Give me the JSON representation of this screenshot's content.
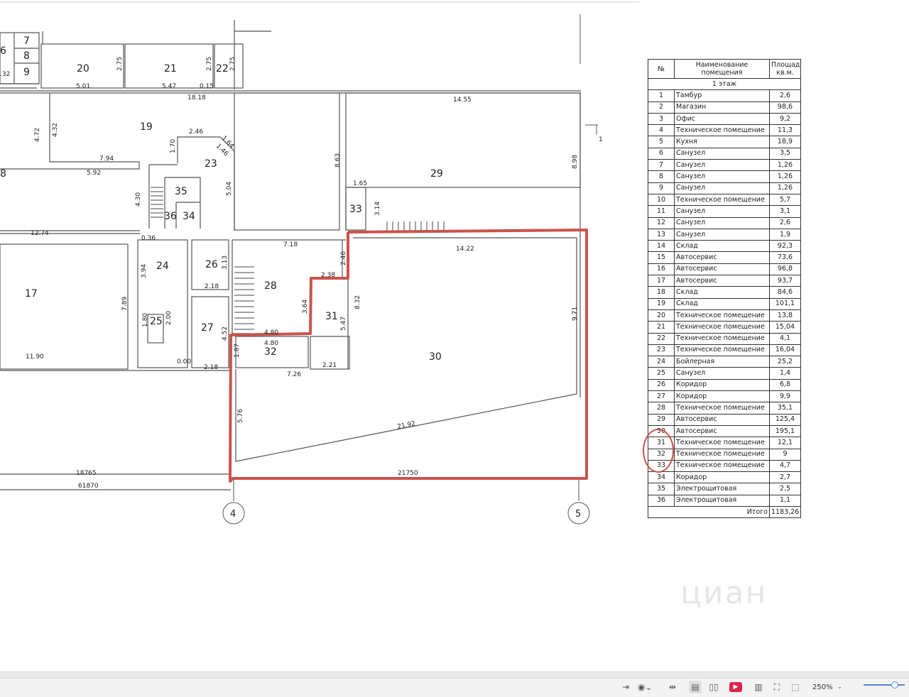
{
  "table": {
    "header_no": "№",
    "header_name": "Наименование помещения",
    "header_area": "Площадь, кв.м.",
    "floor_label": "1 этаж",
    "rooms": [
      {
        "no": "1",
        "name": "Тамбур",
        "area": "2,6"
      },
      {
        "no": "2",
        "name": "Магазин",
        "area": "98,6"
      },
      {
        "no": "3",
        "name": "Офис",
        "area": "9,2"
      },
      {
        "no": "4",
        "name": "Техническое помещение",
        "area": "11,3"
      },
      {
        "no": "5",
        "name": "Кухня",
        "area": "18,9"
      },
      {
        "no": "6",
        "name": "Санузел",
        "area": "3,5"
      },
      {
        "no": "7",
        "name": "Санузел",
        "area": "1,26"
      },
      {
        "no": "8",
        "name": "Санузел",
        "area": "1,26"
      },
      {
        "no": "9",
        "name": "Санузел",
        "area": "1,26"
      },
      {
        "no": "10",
        "name": "Техническое помещение",
        "area": "5,7"
      },
      {
        "no": "11",
        "name": "Санузел",
        "area": "3,1"
      },
      {
        "no": "12",
        "name": "Санузел",
        "area": "2,6"
      },
      {
        "no": "13",
        "name": "Санузел",
        "area": "1,9"
      },
      {
        "no": "14",
        "name": "Склад",
        "area": "92,3"
      },
      {
        "no": "15",
        "name": "Автосервис",
        "area": "73,6"
      },
      {
        "no": "16",
        "name": "Автосервис",
        "area": "96,8"
      },
      {
        "no": "17",
        "name": "Автосервис",
        "area": "93,7"
      },
      {
        "no": "18",
        "name": "Склад",
        "area": "84,6"
      },
      {
        "no": "19",
        "name": "Склад",
        "area": "101,1"
      },
      {
        "no": "20",
        "name": "Техническое помещение",
        "area": "13,8"
      },
      {
        "no": "21",
        "name": "Техническое помещение",
        "area": "15,04"
      },
      {
        "no": "22",
        "name": "Техническое помещение",
        "area": "4,1"
      },
      {
        "no": "23",
        "name": "Техническое помещение",
        "area": "16,04"
      },
      {
        "no": "24",
        "name": "Бойлерная",
        "area": "25,2"
      },
      {
        "no": "25",
        "name": "Санузел",
        "area": "1,4"
      },
      {
        "no": "26",
        "name": "Коридор",
        "area": "6,8"
      },
      {
        "no": "27",
        "name": "Коридор",
        "area": "9,9"
      },
      {
        "no": "28",
        "name": "Техническое помещение",
        "area": "35,1"
      },
      {
        "no": "29",
        "name": "Автосервис",
        "area": "125,4"
      },
      {
        "no": "30",
        "name": "Автосервис",
        "area": "195,1"
      },
      {
        "no": "31",
        "name": "Техническое помещение",
        "area": "12,1"
      },
      {
        "no": "32",
        "name": "Техническое помещение",
        "area": "9"
      },
      {
        "no": "33",
        "name": "Техническое помещение",
        "area": "4,7"
      },
      {
        "no": "34",
        "name": "Коридор",
        "area": "2,7"
      },
      {
        "no": "35",
        "name": "Электрощитовая",
        "area": "2,5"
      },
      {
        "no": "36",
        "name": "Электрощитовая",
        "area": "1,1"
      }
    ],
    "total_label": "Итого",
    "total_value": "1183,26"
  },
  "plan": {
    "rooms": {
      "r6": "6",
      "r7": "7",
      "r8": "8",
      "r9": "9",
      "r20": "20",
      "r21": "21",
      "r22": "22",
      "r19": "19",
      "r23": "23",
      "r29": "29",
      "r18": "8",
      "r35": "35",
      "r36": "36",
      "r34": "34",
      "r33": "33",
      "r17": "17",
      "r24": "24",
      "r26": "26",
      "r28": "28",
      "r31": "31",
      "r25": "25",
      "r27": "27",
      "r32": "32",
      "r30": "30"
    },
    "dims": {
      "d501": "5.01",
      "d547": "5.47",
      "d015": "0.15",
      "d275a": "2.75",
      "d275b": "2.75",
      "d275c": "2.75",
      "d32": ".32",
      "d1818": "18.18",
      "d1455": "14.55",
      "d472": "4.72",
      "d432": "4.32",
      "d246": "2.46",
      "d164": "1.64",
      "d146": "1.46",
      "d170": "1.70",
      "d794": "7.94",
      "d592": "5.92",
      "d863": "8.63",
      "d165": "1.65",
      "d314": "3.14",
      "d898": "8.98",
      "d504": "5.04",
      "d430": "4.30",
      "d1274": "12.74",
      "d036": "0.36",
      "d718": "7.18",
      "d1422": "14.22",
      "d246b": "2.46",
      "d238": "2.38",
      "d394": "3.94",
      "d313": "3.13",
      "d218a": "2.18",
      "d364": "3.64",
      "d832": "8.32",
      "d547b": "5.47",
      "d789": "7.89",
      "d180": "1.80",
      "d200": "2.00",
      "d452": "4.52",
      "d480": "4.80",
      "d187": "1.87",
      "d971": "9.71",
      "d1190": "11.90",
      "d000": "0.00",
      "d218b": "2.18",
      "d726": "7.26",
      "d221": "2.21",
      "d576": "5.76",
      "d2192": "21.92",
      "d18765": "18765",
      "d21750": "21750",
      "d61870": "61870"
    },
    "axis_4": "4",
    "axis_5": "5",
    "section_mark": "1",
    "highlight_color": "#c9544d"
  },
  "watermark": "циан",
  "toolbar": {
    "zoom": "250%",
    "zoom_caret": "⌄"
  }
}
